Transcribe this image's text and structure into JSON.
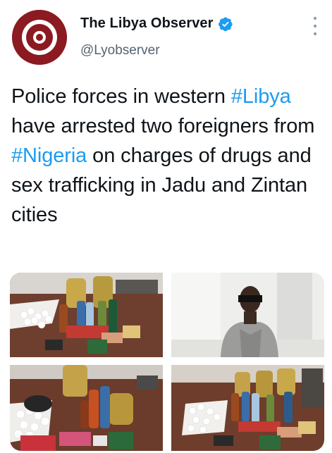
{
  "account": {
    "display_name": "The Libya Observer",
    "handle": "@Lyobserver",
    "verified": true,
    "brand_color": "#8b1a21",
    "verified_color": "#1d9bf0"
  },
  "tweet": {
    "text_part1": "Police forces in western ",
    "hashtag1": "#Libya",
    "text_part2": " have arrested two foreigners from ",
    "hashtag2": "#Nigeria",
    "text_part3": " on charges of drugs and sex trafficking in Jadu and Zintan cities",
    "hashtag_color": "#1d9bf0"
  },
  "media": {
    "count": 4,
    "items": [
      {
        "name": "seized-items-photo-1"
      },
      {
        "name": "suspect-photo"
      },
      {
        "name": "seized-items-photo-2"
      },
      {
        "name": "seized-items-photo-3"
      }
    ]
  },
  "icons": {
    "verified": "verified-badge-icon",
    "more": "more-options-icon"
  }
}
